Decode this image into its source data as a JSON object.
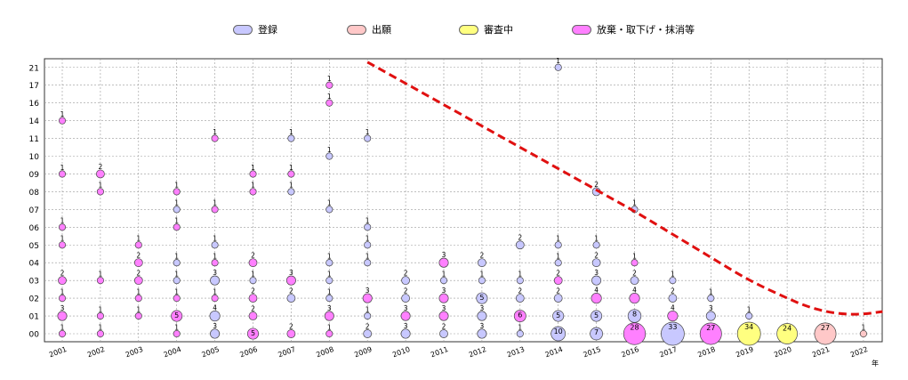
{
  "chart_data": {
    "type": "scatter",
    "title": "",
    "xlabel": "",
    "x_unit_label": "年",
    "ylabel": "",
    "grid": true,
    "legend_position": "top",
    "categories": [
      "2001",
      "2002",
      "2003",
      "2004",
      "2005",
      "2006",
      "2007",
      "2008",
      "2009",
      "2010",
      "2011",
      "2012",
      "2013",
      "2014",
      "2015",
      "2016",
      "2017",
      "2018",
      "2019",
      "2020",
      "2021",
      "2022"
    ],
    "y_categories": [
      "00",
      "01",
      "02",
      "03",
      "04",
      "05",
      "06",
      "07",
      "08",
      "09",
      "10",
      "11",
      "14",
      "16",
      "17",
      "21"
    ],
    "legend": [
      {
        "label": "登録",
        "color": "#c8c8ff"
      },
      {
        "label": "出願",
        "color": "#ffc8c8"
      },
      {
        "label": "審査中",
        "color": "#ffff80"
      },
      {
        "label": "放棄・取下げ・抹消等",
        "color": "#ff80ff"
      }
    ],
    "colors": {
      "registered": "#c8c8ff",
      "filed": "#ffc8c8",
      "pending": "#ffff80",
      "abandoned": "#ff80ff",
      "trend": "#e01010"
    },
    "bubbles": [
      {
        "x": "2001",
        "y": "00",
        "count": 1,
        "kind": "abandoned"
      },
      {
        "x": "2001",
        "y": "01",
        "count": 3,
        "kind": "abandoned"
      },
      {
        "x": "2001",
        "y": "02",
        "count": 1,
        "kind": "abandoned"
      },
      {
        "x": "2001",
        "y": "03",
        "count": 2,
        "kind": "abandoned"
      },
      {
        "x": "2001",
        "y": "05",
        "count": 1,
        "kind": "abandoned"
      },
      {
        "x": "2001",
        "y": "06",
        "count": 1,
        "kind": "abandoned"
      },
      {
        "x": "2001",
        "y": "09",
        "count": 1,
        "kind": "abandoned"
      },
      {
        "x": "2001",
        "y": "14",
        "count": 1,
        "kind": "abandoned"
      },
      {
        "x": "2002",
        "y": "00",
        "count": 1,
        "kind": "abandoned"
      },
      {
        "x": "2002",
        "y": "01",
        "count": 1,
        "kind": "abandoned"
      },
      {
        "x": "2002",
        "y": "03",
        "count": 1,
        "kind": "abandoned"
      },
      {
        "x": "2002",
        "y": "08",
        "count": 1,
        "kind": "abandoned"
      },
      {
        "x": "2002",
        "y": "09",
        "count": 2,
        "kind": "abandoned"
      },
      {
        "x": "2003",
        "y": "01",
        "count": 1,
        "kind": "abandoned"
      },
      {
        "x": "2003",
        "y": "02",
        "count": 1,
        "kind": "abandoned"
      },
      {
        "x": "2003",
        "y": "03",
        "count": 2,
        "kind": "abandoned"
      },
      {
        "x": "2003",
        "y": "04",
        "count": 2,
        "kind": "abandoned"
      },
      {
        "x": "2003",
        "y": "05",
        "count": 1,
        "kind": "abandoned"
      },
      {
        "x": "2004",
        "y": "00",
        "count": 1,
        "kind": "abandoned"
      },
      {
        "x": "2004",
        "y": "01",
        "count": 5,
        "kind": "abandoned"
      },
      {
        "x": "2004",
        "y": "02",
        "count": 1,
        "kind": "abandoned"
      },
      {
        "x": "2004",
        "y": "03",
        "count": 1,
        "kind": "registered"
      },
      {
        "x": "2004",
        "y": "04",
        "count": 1,
        "kind": "registered"
      },
      {
        "x": "2004",
        "y": "06",
        "count": 1,
        "kind": "abandoned"
      },
      {
        "x": "2004",
        "y": "07",
        "count": 1,
        "kind": "registered"
      },
      {
        "x": "2004",
        "y": "08",
        "count": 1,
        "kind": "abandoned"
      },
      {
        "x": "2005",
        "y": "00",
        "count": 3,
        "kind": "registered"
      },
      {
        "x": "2005",
        "y": "01",
        "count": 4,
        "kind": "registered"
      },
      {
        "x": "2005",
        "y": "02",
        "count": 1,
        "kind": "abandoned"
      },
      {
        "x": "2005",
        "y": "03",
        "count": 3,
        "kind": "registered"
      },
      {
        "x": "2005",
        "y": "04",
        "count": 1,
        "kind": "abandoned"
      },
      {
        "x": "2005",
        "y": "05",
        "count": 1,
        "kind": "registered"
      },
      {
        "x": "2005",
        "y": "07",
        "count": 1,
        "kind": "abandoned"
      },
      {
        "x": "2005",
        "y": "11",
        "count": 1,
        "kind": "abandoned"
      },
      {
        "x": "2006",
        "y": "00",
        "count": 5,
        "kind": "abandoned"
      },
      {
        "x": "2006",
        "y": "01",
        "count": 2,
        "kind": "abandoned"
      },
      {
        "x": "2006",
        "y": "02",
        "count": 2,
        "kind": "abandoned"
      },
      {
        "x": "2006",
        "y": "03",
        "count": 1,
        "kind": "registered"
      },
      {
        "x": "2006",
        "y": "04",
        "count": 2,
        "kind": "abandoned"
      },
      {
        "x": "2006",
        "y": "08",
        "count": 1,
        "kind": "abandoned"
      },
      {
        "x": "2006",
        "y": "09",
        "count": 1,
        "kind": "abandoned"
      },
      {
        "x": "2007",
        "y": "00",
        "count": 2,
        "kind": "abandoned"
      },
      {
        "x": "2007",
        "y": "02",
        "count": 2,
        "kind": "registered"
      },
      {
        "x": "2007",
        "y": "03",
        "count": 3,
        "kind": "abandoned"
      },
      {
        "x": "2007",
        "y": "08",
        "count": 1,
        "kind": "registered"
      },
      {
        "x": "2007",
        "y": "09",
        "count": 1,
        "kind": "abandoned"
      },
      {
        "x": "2007",
        "y": "11",
        "count": 1,
        "kind": "registered"
      },
      {
        "x": "2008",
        "y": "00",
        "count": 1,
        "kind": "abandoned"
      },
      {
        "x": "2008",
        "y": "01",
        "count": 3,
        "kind": "abandoned"
      },
      {
        "x": "2008",
        "y": "02",
        "count": 1,
        "kind": "registered"
      },
      {
        "x": "2008",
        "y": "03",
        "count": 1,
        "kind": "registered"
      },
      {
        "x": "2008",
        "y": "04",
        "count": 1,
        "kind": "registered"
      },
      {
        "x": "2008",
        "y": "07",
        "count": 1,
        "kind": "registered"
      },
      {
        "x": "2008",
        "y": "10",
        "count": 1,
        "kind": "registered"
      },
      {
        "x": "2008",
        "y": "16",
        "count": 1,
        "kind": "abandoned"
      },
      {
        "x": "2008",
        "y": "17",
        "count": 1,
        "kind": "abandoned"
      },
      {
        "x": "2009",
        "y": "00",
        "count": 2,
        "kind": "registered"
      },
      {
        "x": "2009",
        "y": "01",
        "count": 1,
        "kind": "registered"
      },
      {
        "x": "2009",
        "y": "02",
        "count": 3,
        "kind": "abandoned"
      },
      {
        "x": "2009",
        "y": "04",
        "count": 1,
        "kind": "registered"
      },
      {
        "x": "2009",
        "y": "05",
        "count": 1,
        "kind": "registered"
      },
      {
        "x": "2009",
        "y": "06",
        "count": 1,
        "kind": "registered"
      },
      {
        "x": "2009",
        "y": "11",
        "count": 1,
        "kind": "registered"
      },
      {
        "x": "2010",
        "y": "00",
        "count": 3,
        "kind": "registered"
      },
      {
        "x": "2010",
        "y": "01",
        "count": 3,
        "kind": "abandoned"
      },
      {
        "x": "2010",
        "y": "02",
        "count": 2,
        "kind": "registered"
      },
      {
        "x": "2010",
        "y": "03",
        "count": 2,
        "kind": "registered"
      },
      {
        "x": "2011",
        "y": "00",
        "count": 2,
        "kind": "registered"
      },
      {
        "x": "2011",
        "y": "01",
        "count": 3,
        "kind": "abandoned"
      },
      {
        "x": "2011",
        "y": "02",
        "count": 3,
        "kind": "abandoned"
      },
      {
        "x": "2011",
        "y": "03",
        "count": 1,
        "kind": "registered"
      },
      {
        "x": "2011",
        "y": "04",
        "count": 3,
        "kind": "abandoned"
      },
      {
        "x": "2012",
        "y": "00",
        "count": 3,
        "kind": "registered"
      },
      {
        "x": "2012",
        "y": "01",
        "count": 3,
        "kind": "registered"
      },
      {
        "x": "2012",
        "y": "02",
        "count": 5,
        "kind": "registered"
      },
      {
        "x": "2012",
        "y": "03",
        "count": 1,
        "kind": "registered"
      },
      {
        "x": "2012",
        "y": "04",
        "count": 2,
        "kind": "registered"
      },
      {
        "x": "2013",
        "y": "00",
        "count": 1,
        "kind": "registered"
      },
      {
        "x": "2013",
        "y": "01",
        "count": 6,
        "kind": "abandoned"
      },
      {
        "x": "2013",
        "y": "02",
        "count": 2,
        "kind": "registered"
      },
      {
        "x": "2013",
        "y": "03",
        "count": 1,
        "kind": "registered"
      },
      {
        "x": "2013",
        "y": "05",
        "count": 2,
        "kind": "registered"
      },
      {
        "x": "2014",
        "y": "00",
        "count": 10,
        "kind": "registered"
      },
      {
        "x": "2014",
        "y": "01",
        "count": 5,
        "kind": "registered"
      },
      {
        "x": "2014",
        "y": "02",
        "count": 2,
        "kind": "registered"
      },
      {
        "x": "2014",
        "y": "03",
        "count": 2,
        "kind": "abandoned"
      },
      {
        "x": "2014",
        "y": "04",
        "count": 1,
        "kind": "registered"
      },
      {
        "x": "2014",
        "y": "05",
        "count": 1,
        "kind": "registered"
      },
      {
        "x": "2014",
        "y": "21",
        "count": 1,
        "kind": "registered"
      },
      {
        "x": "2015",
        "y": "00",
        "count": 7,
        "kind": "registered"
      },
      {
        "x": "2015",
        "y": "01",
        "count": 5,
        "kind": "registered"
      },
      {
        "x": "2015",
        "y": "02",
        "count": 4,
        "kind": "abandoned"
      },
      {
        "x": "2015",
        "y": "03",
        "count": 3,
        "kind": "registered"
      },
      {
        "x": "2015",
        "y": "04",
        "count": 2,
        "kind": "registered"
      },
      {
        "x": "2015",
        "y": "05",
        "count": 1,
        "kind": "registered"
      },
      {
        "x": "2015",
        "y": "08",
        "count": 2,
        "kind": "registered"
      },
      {
        "x": "2016",
        "y": "00",
        "count": 28,
        "kind": "abandoned"
      },
      {
        "x": "2016",
        "y": "01",
        "count": 8,
        "kind": "registered"
      },
      {
        "x": "2016",
        "y": "02",
        "count": 4,
        "kind": "abandoned"
      },
      {
        "x": "2016",
        "y": "03",
        "count": 2,
        "kind": "registered"
      },
      {
        "x": "2016",
        "y": "04",
        "count": 1,
        "kind": "abandoned"
      },
      {
        "x": "2016",
        "y": "07",
        "count": 1,
        "kind": "registered"
      },
      {
        "x": "2017",
        "y": "00",
        "count": 33,
        "kind": "registered"
      },
      {
        "x": "2017",
        "y": "01",
        "count": 4,
        "kind": "abandoned"
      },
      {
        "x": "2017",
        "y": "02",
        "count": 2,
        "kind": "registered"
      },
      {
        "x": "2017",
        "y": "03",
        "count": 1,
        "kind": "registered"
      },
      {
        "x": "2018",
        "y": "00",
        "count": 27,
        "kind": "abandoned"
      },
      {
        "x": "2018",
        "y": "01",
        "count": 3,
        "kind": "registered"
      },
      {
        "x": "2018",
        "y": "02",
        "count": 1,
        "kind": "registered"
      },
      {
        "x": "2019",
        "y": "00",
        "count": 34,
        "kind": "pending"
      },
      {
        "x": "2019",
        "y": "01",
        "count": 1,
        "kind": "registered"
      },
      {
        "x": "2020",
        "y": "00",
        "count": 24,
        "kind": "pending"
      },
      {
        "x": "2021",
        "y": "00",
        "count": 27,
        "kind": "filed"
      },
      {
        "x": "2022",
        "y": "00",
        "count": 1,
        "kind": "filed"
      }
    ],
    "trend_curve": [
      {
        "x": 2009.0,
        "y_index": 15.3
      },
      {
        "x": 2010.0,
        "y_index": 14.1
      },
      {
        "x": 2011.0,
        "y_index": 12.9
      },
      {
        "x": 2012.0,
        "y_index": 11.7
      },
      {
        "x": 2013.0,
        "y_index": 10.5
      },
      {
        "x": 2014.0,
        "y_index": 9.3
      },
      {
        "x": 2015.0,
        "y_index": 8.1
      },
      {
        "x": 2016.0,
        "y_index": 6.9
      },
      {
        "x": 2017.0,
        "y_index": 5.6
      },
      {
        "x": 2018.0,
        "y_index": 4.3
      },
      {
        "x": 2019.0,
        "y_index": 3.0
      },
      {
        "x": 2020.0,
        "y_index": 2.0
      },
      {
        "x": 2020.5,
        "y_index": 1.55
      },
      {
        "x": 2021.0,
        "y_index": 1.25
      },
      {
        "x": 2021.5,
        "y_index": 1.1
      },
      {
        "x": 2022.0,
        "y_index": 1.1
      },
      {
        "x": 2022.5,
        "y_index": 1.25
      }
    ]
  }
}
